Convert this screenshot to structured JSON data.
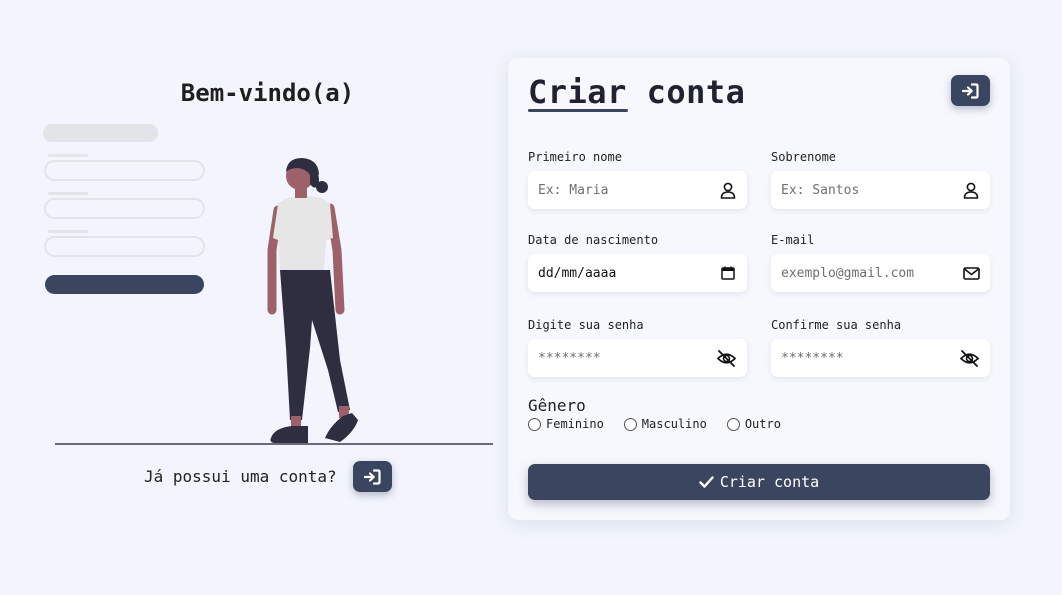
{
  "welcome": {
    "title": "Bem-vindo(a)",
    "login_question": "Já possui uma conta?",
    "login_icon": "sign-in-icon"
  },
  "form": {
    "title": "Criar conta",
    "header_login_icon": "sign-in-icon",
    "fields": {
      "first_name": {
        "label": "Primeiro nome",
        "placeholder": "Ex: Maria",
        "icon": "user-icon"
      },
      "last_name": {
        "label": "Sobrenome",
        "placeholder": "Ex: Santos",
        "icon": "user-icon"
      },
      "birth_date": {
        "label": "Data de nascimento",
        "value": "dd/mm/aaaa",
        "icon": "calendar-icon"
      },
      "email": {
        "label": "E-mail",
        "placeholder": "exemplo@gmail.com",
        "icon": "envelope-icon"
      },
      "password": {
        "label": "Digite sua senha",
        "placeholder": "********",
        "icon": "eye-slash-icon"
      },
      "confirm_password": {
        "label": "Confirme sua senha",
        "placeholder": "********",
        "icon": "eye-slash-icon"
      }
    },
    "gender": {
      "label": "Gênero",
      "options": [
        "Feminino",
        "Masculino",
        "Outro"
      ]
    },
    "submit_label": "Criar conta",
    "submit_icon": "check-icon"
  },
  "colors": {
    "background": "#f2f5fd",
    "primary": "#3a455f",
    "card": "#f6f8fd"
  }
}
